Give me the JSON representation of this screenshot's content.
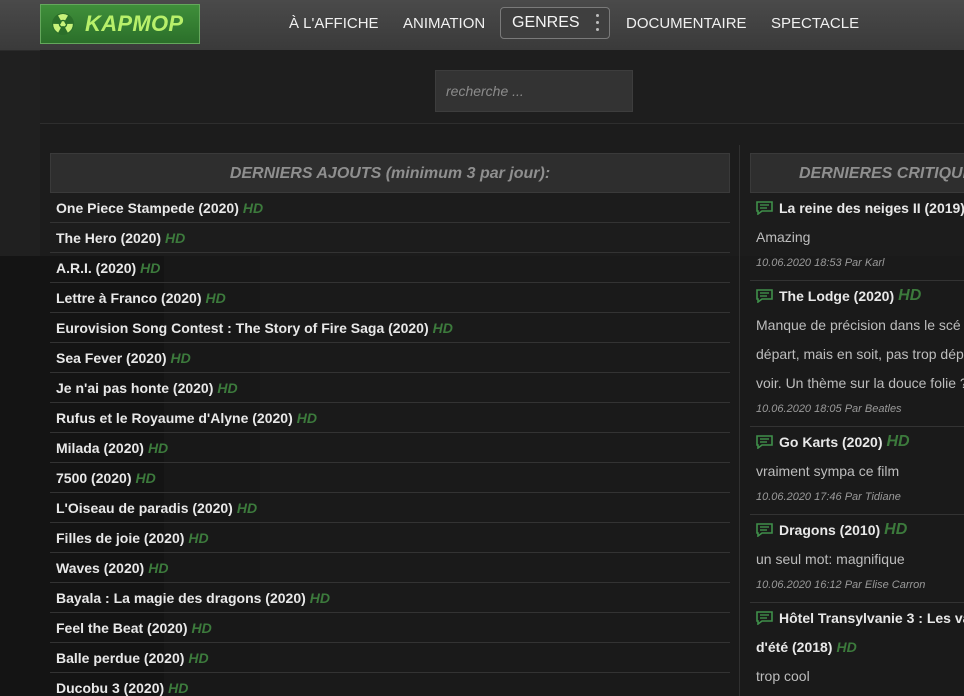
{
  "brand": {
    "logo_text": "KAPMOP"
  },
  "nav": {
    "items": [
      "À L'AFFICHE",
      "ANIMATION",
      "DOCUMENTAIRE",
      "SPECTACLE"
    ],
    "genres_label": "GENRES"
  },
  "search": {
    "placeholder": "recherche ..."
  },
  "latest": {
    "heading": "DERNIERS AJOUTS (minimum 3 par jour):",
    "items": [
      {
        "title": "One Piece Stampede (2020)",
        "badge": "HD"
      },
      {
        "title": "The Hero (2020)",
        "badge": "HD"
      },
      {
        "title": "A.R.I. (2020)",
        "badge": "HD"
      },
      {
        "title": "Lettre à Franco (2020)",
        "badge": "HD"
      },
      {
        "title": "Eurovision Song Contest : The Story of Fire Saga (2020)",
        "badge": "HD"
      },
      {
        "title": "Sea Fever (2020)",
        "badge": "HD"
      },
      {
        "title": "Je n'ai pas honte (2020)",
        "badge": "HD"
      },
      {
        "title": "Rufus et le Royaume d'Alyne (2020)",
        "badge": "HD"
      },
      {
        "title": "Milada (2020)",
        "badge": "HD"
      },
      {
        "title": "7500 (2020)",
        "badge": "HD"
      },
      {
        "title": "L'Oiseau de paradis (2020)",
        "badge": "HD"
      },
      {
        "title": "Filles de joie (2020)",
        "badge": "HD"
      },
      {
        "title": "Waves (2020)",
        "badge": "HD"
      },
      {
        "title": "Bayala : La magie des dragons (2020)",
        "badge": "HD"
      },
      {
        "title": "Feel the Beat (2020)",
        "badge": "HD"
      },
      {
        "title": "Balle perdue (2020)",
        "badge": "HD"
      },
      {
        "title": "Ducobu 3 (2020)",
        "badge": "HD"
      }
    ]
  },
  "reviews": {
    "heading": "DERNIERES CRITIQUES",
    "items": [
      {
        "title": "La reine des neiges II (2019)",
        "badge": "",
        "text": [
          "Amazing"
        ],
        "meta": "10.06.2020 18:53 Par Karl"
      },
      {
        "title": "The Lodge (2020)",
        "badge": "HD",
        "text": [
          "Manque de précision dans le scé",
          "départ, mais en soit, pas trop dép",
          "voir. Un thème sur la douce folie ?"
        ],
        "meta": "10.06.2020 18:05 Par Beatles"
      },
      {
        "title": "Go Karts (2020)",
        "badge": "HD",
        "text": [
          "vraiment sympa ce film"
        ],
        "meta": "10.06.2020 17:46 Par Tidiane"
      },
      {
        "title": "Dragons (2010)",
        "badge": "HD",
        "text": [
          "un seul mot: magnifique"
        ],
        "meta": "10.06.2020 16:12 Par Elise Carron"
      },
      {
        "title": "Hôtel Transylvanie 3 : Les va",
        "title_line2": "d'été (2018)",
        "badge": "HD",
        "text": [
          "trop cool"
        ],
        "meta": ""
      }
    ]
  },
  "colors": {
    "accent_green": "#3c7a3c",
    "logo_text": "#b8f06a",
    "logo_bg": "#2b6f2a"
  },
  "icons": {
    "logo": "radiation-icon",
    "review": "comment-icon",
    "genres_menu": "more-vertical-icon"
  }
}
